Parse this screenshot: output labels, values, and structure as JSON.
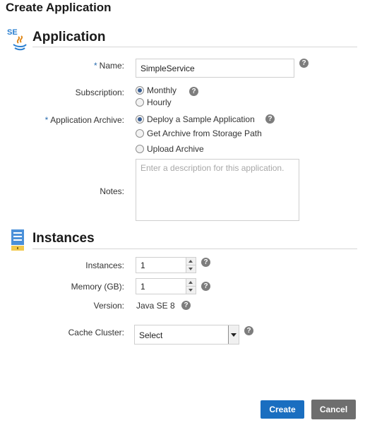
{
  "page": {
    "title": "Create Application"
  },
  "application": {
    "section_title": "Application",
    "badge": "SE",
    "name": {
      "required_mark": "*",
      "label": "Name:",
      "value": "SimpleService"
    },
    "subscription": {
      "label": "Subscription:",
      "options": [
        "Monthly",
        "Hourly"
      ],
      "selected": "Monthly"
    },
    "archive": {
      "required_mark": "*",
      "label": "Application Archive:",
      "options": [
        "Deploy a Sample Application",
        "Get Archive from Storage Path",
        "Upload Archive"
      ],
      "selected": "Deploy a Sample Application"
    },
    "notes": {
      "label": "Notes:",
      "placeholder": "Enter a description for this application."
    }
  },
  "instances": {
    "section_title": "Instances",
    "instances_field": {
      "label": "Instances:",
      "value": "1"
    },
    "memory_field": {
      "label": "Memory (GB):",
      "value": "1"
    },
    "version": {
      "label": "Version:",
      "value": "Java SE 8"
    },
    "cache_cluster": {
      "label": "Cache Cluster:",
      "value": "Select"
    }
  },
  "help_glyph": "?",
  "footer": {
    "create_label": "Create",
    "cancel_label": "Cancel"
  },
  "colors": {
    "accent": "#1a6ec0",
    "secondary_button": "#6e6e6e",
    "help_icon": "#7d7d7d"
  }
}
